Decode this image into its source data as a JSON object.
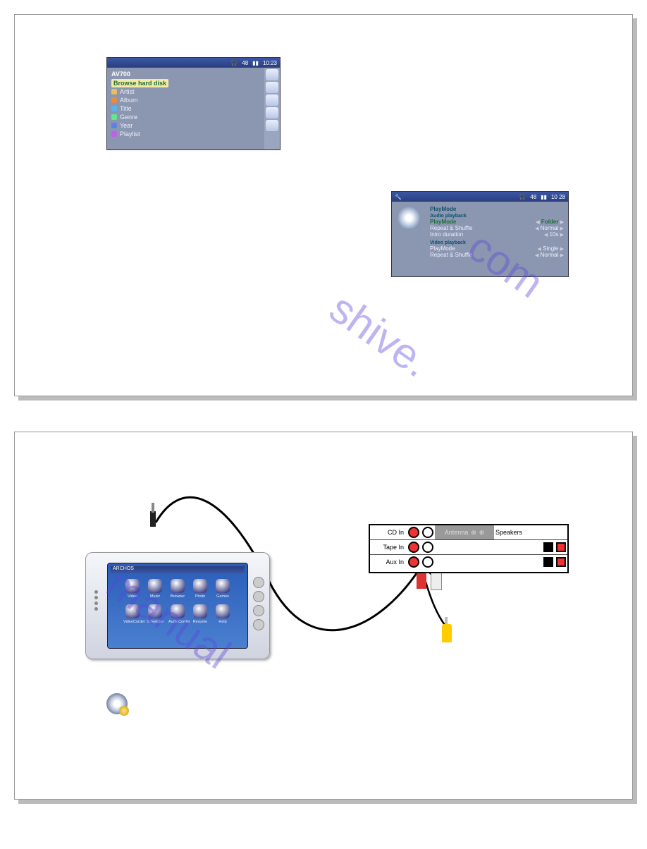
{
  "browserScreen": {
    "title": "AV700",
    "status": {
      "battery": "48",
      "time": "10:23",
      "headphones": true
    },
    "highlight": "Browse hard disk",
    "items": [
      "Artist",
      "Album",
      "Title",
      "Genre",
      "Year",
      "Playlist"
    ]
  },
  "settingsScreen": {
    "status": {
      "battery": "48",
      "time": "10 28",
      "headphones": true
    },
    "section_title": "PlayMode",
    "section_a_label": "Audio playback",
    "section_a_rows": [
      {
        "label": "PlayMode",
        "value": "Folder",
        "highlight": true
      },
      {
        "label": "Repeat & Shuffle",
        "value": "Normal"
      },
      {
        "label": "Intro duration",
        "value": "10s"
      }
    ],
    "section_b_label": "Video playback",
    "section_b_rows": [
      {
        "label": "PlayMode",
        "value": "Single"
      },
      {
        "label": "Repeat & Shuffle",
        "value": "Normal"
      }
    ]
  },
  "watermark_a": "shive.",
  "watermark_b": "com",
  "watermark_c": "manual",
  "device": {
    "brand": "ARCHOS",
    "icons_row1": [
      {
        "label": "Video"
      },
      {
        "label": "Music"
      },
      {
        "label": "Browser"
      },
      {
        "label": "Photo"
      },
      {
        "label": "Games"
      }
    ],
    "icons_row2": [
      {
        "label": "VideoCorder"
      },
      {
        "label": "Scheduler"
      },
      {
        "label": "AudioCorder"
      },
      {
        "label": "Resume"
      },
      {
        "label": "Help"
      }
    ]
  },
  "amp": {
    "rows": [
      "CD In",
      "Tape In",
      "Aux In"
    ],
    "antenna": "Antenna",
    "speakers": "Speakers"
  }
}
